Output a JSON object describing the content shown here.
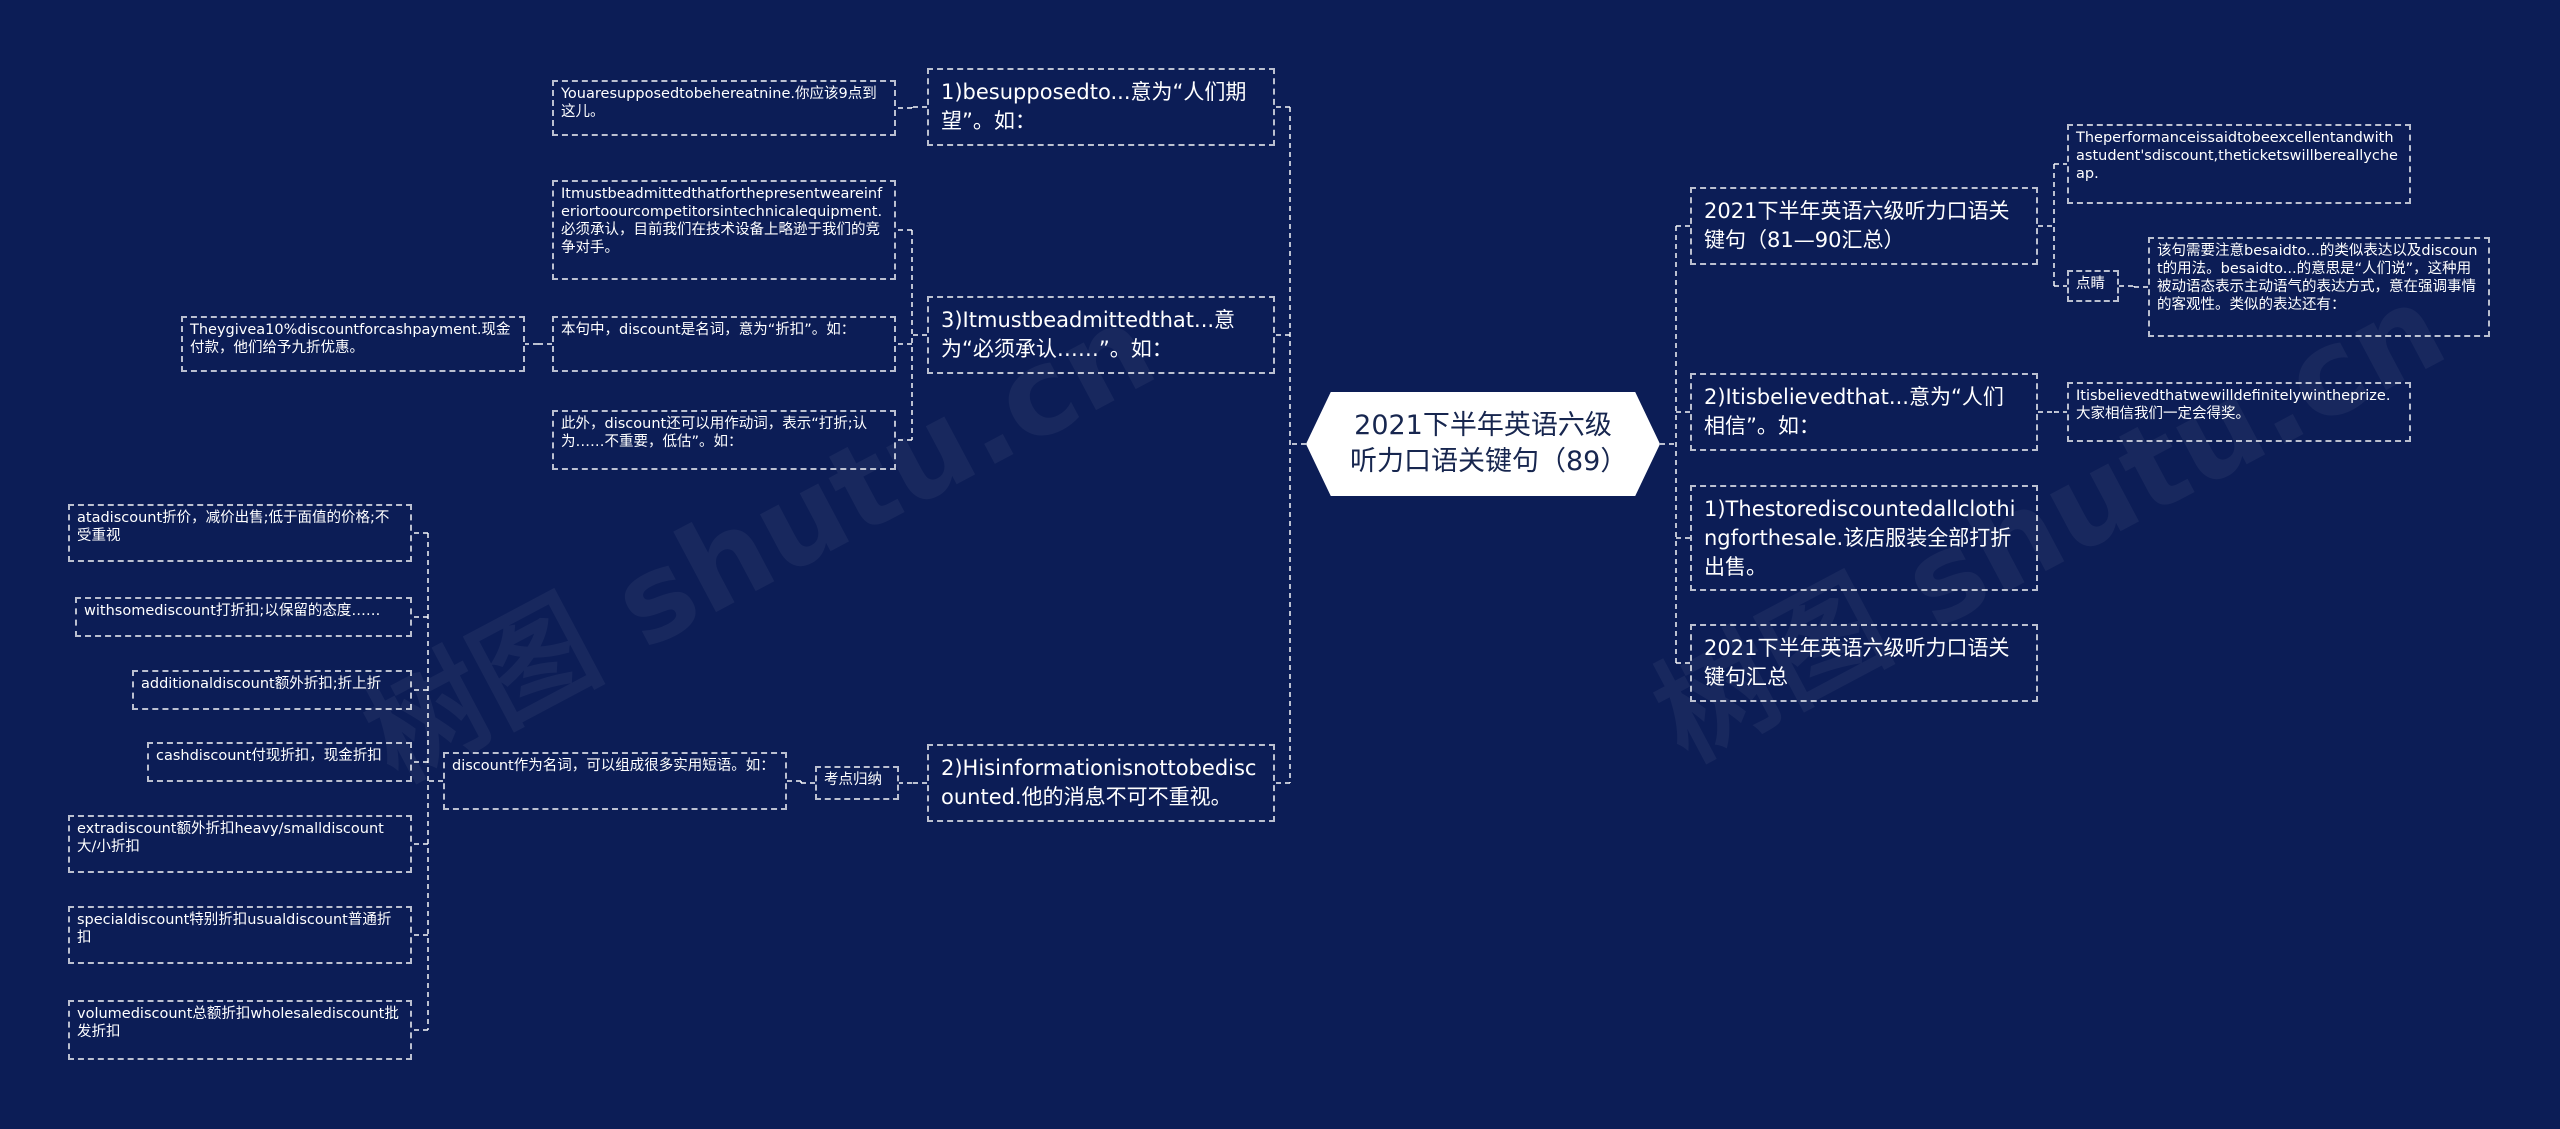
{
  "root": {
    "title": "2021下半年英语六级听力口语关键句（89）"
  },
  "watermark": "树图 shutu.cn",
  "right": {
    "b1": {
      "label": "2021下半年英语六级听力口语关键句（81—90汇总）",
      "c1": "Theperformanceissaidtobeexcellentandwithastudent'sdiscount,theticketswillbereallycheap.",
      "c2": "点睛",
      "c2_child": "该句需要注意besaidto...的类似表达以及discount的用法。besaidto...的意思是“人们说”，这种用被动语态表示主动语气的表达方式，意在强调事情的客观性。类似的表达还有："
    },
    "b2": {
      "label": "2)Itisbelievedthat...意为“人们相信”。如：",
      "c1": "Itisbelievedthatwewilldefinitelywintheprize.大家相信我们一定会得奖。"
    },
    "b3": {
      "label": "1)Thestorediscountedallclothingforthesale.该店服装全部打折出售。"
    },
    "b4": {
      "label": "2021下半年英语六级听力口语关键句汇总"
    }
  },
  "left": {
    "b1": {
      "label": "1)besupposedto...意为“人们期望”。如：",
      "c1": "Youaresupposedtobehereatnine.你应该9点到这儿。"
    },
    "b2": {
      "label": "3)Itmustbeadmittedthat...意为“必须承认……”。如：",
      "c1": "Itmustbeadmittedthatforthepresentweareinferiortoourcompetitorsintechnicalequipment.必须承认，目前我们在技术设备上略逊于我们的竞争对手。",
      "c2": "本句中，discount是名词，意为“折扣”。如：",
      "c2_child": "Theygivea10%discountforcashpayment.现金付款，他们给予九折优惠。",
      "c3": "此外，discount还可以用作动词，表示“打折;认为……不重要，低估”。如："
    },
    "b3": {
      "label": "2)Hisinformationisnottobediscounted.他的消息不可不重视。",
      "c1": "考点归纳",
      "c1_child": "discount作为名词，可以组成很多实用短语。如：",
      "phrases": [
        "atadiscount折价，减价出售;低于面值的价格;不受重视",
        "withsomediscount打折扣;以保留的态度……",
        "additionaldiscount额外折扣;折上折",
        "cashdiscount付现折扣，现金折扣",
        "extradiscount额外折扣heavy/smalldiscount大/小折扣",
        "specialdiscount特别折扣usualdiscount普通折扣",
        "volumediscount总额折扣wholesalediscount批发折扣"
      ]
    }
  }
}
